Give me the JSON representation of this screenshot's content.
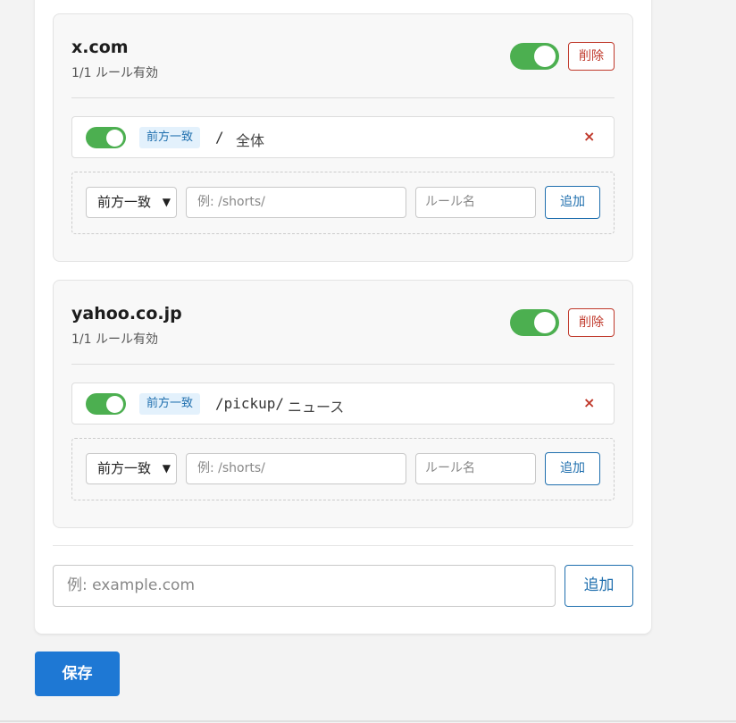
{
  "sites": [
    {
      "domain": "x.com",
      "summary": "1/1 ルール有効",
      "enabled": true,
      "delete_label": "削除",
      "rules": [
        {
          "enabled": true,
          "match_type": "前方一致",
          "path": "/",
          "name": "全体",
          "remove_icon": "×"
        }
      ],
      "new_rule": {
        "match_type": "前方一致",
        "path_placeholder": "例: /shorts/",
        "name_placeholder": "ルール名",
        "add_label": "追加"
      }
    },
    {
      "domain": "yahoo.co.jp",
      "summary": "1/1 ルール有効",
      "enabled": true,
      "delete_label": "削除",
      "rules": [
        {
          "enabled": true,
          "match_type": "前方一致",
          "path": "/pickup/",
          "name": "ニュース",
          "remove_icon": "×"
        }
      ],
      "new_rule": {
        "match_type": "前方一致",
        "path_placeholder": "例: /shorts/",
        "name_placeholder": "ルール名",
        "add_label": "追加"
      }
    }
  ],
  "new_site": {
    "placeholder": "例: example.com",
    "add_label": "追加"
  },
  "save_label": "保存",
  "colors": {
    "toggle_on": "#4caf50",
    "accent": "#1e78d4",
    "danger": "#c0392b",
    "badge_bg": "#e3f1fc",
    "badge_text": "#1f6fae"
  }
}
